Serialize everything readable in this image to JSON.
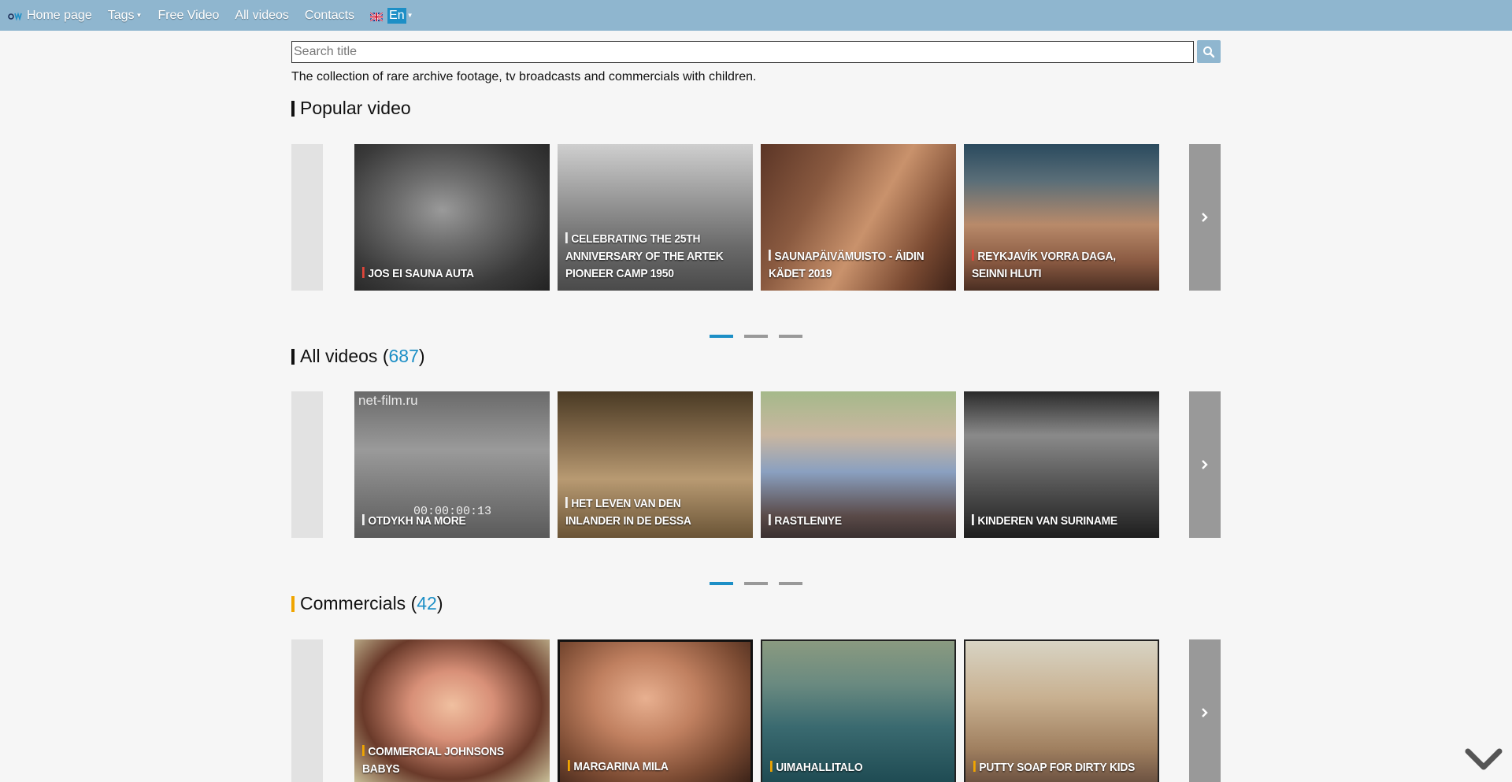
{
  "nav": {
    "items": [
      {
        "label": "Home page"
      },
      {
        "label": "Tags"
      },
      {
        "label": "Free Video"
      },
      {
        "label": "All videos"
      },
      {
        "label": "Contacts"
      }
    ],
    "language": "En"
  },
  "search": {
    "placeholder": "Search title"
  },
  "tagline": "The collection of rare archive footage, tv broadcasts and commercials with children.",
  "popular": {
    "title": "Popular video",
    "cards": [
      {
        "title": "JOS EI SAUNA AUTA"
      },
      {
        "title": "CELEBRATING THE 25TH ANNIVERSARY OF THE ARTEK PIONEER CAMP 1950"
      },
      {
        "title": "SAUNAPÄIVÄMUISTO - ÄIDIN KÄDET 2019"
      },
      {
        "title": "REYKJAVÍK VORRA DAGA, SEINNI HLUTI"
      }
    ]
  },
  "all_videos": {
    "title": "All videos (",
    "count": "687",
    "close": ")",
    "cards": [
      {
        "title": "OTDYKH NA MORE",
        "watermark": "net-film.ru",
        "timecode": "00:00:00:13"
      },
      {
        "title": "HET LEVEN VAN DEN INLANDER IN DE DESSA"
      },
      {
        "title": "RASTLENIYE"
      },
      {
        "title": "KINDEREN VAN SURINAME"
      }
    ]
  },
  "commercials": {
    "title": "Commercials (",
    "count": "42",
    "close": ")",
    "cards": [
      {
        "title": "COMMERCIAL JOHNSONS BABYS"
      },
      {
        "title": "MARGARINA MILA"
      },
      {
        "title": "UIMAHALLITALO"
      },
      {
        "title": "PUTTY SOAP FOR DIRTY KIDS"
      }
    ]
  },
  "colors": {
    "nav_bg": "#8fb6cf",
    "accent": "#1d8fc6",
    "commercial_mark": "#f0a500",
    "popular_mark": "#e0453a"
  },
  "icons": {
    "search": "search-icon",
    "next": "chevron-right-icon",
    "scroll": "chevron-down-icon",
    "flag": "uk-flag-icon"
  }
}
